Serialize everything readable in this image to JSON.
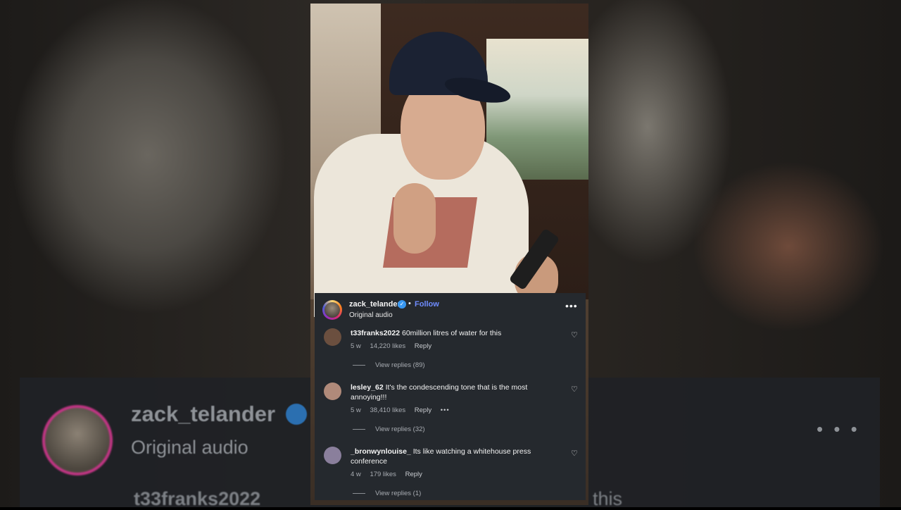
{
  "background": {
    "username": "zack_telander",
    "audio_label": "Original audio",
    "comment_user": "t33franks2022",
    "comment_fragment": "this",
    "more_icon": "• • •"
  },
  "overlay": {
    "header": {
      "username": "zack_telander",
      "separator": "•",
      "follow_label": "Follow",
      "audio_label": "Original audio",
      "more_icon": "•••"
    },
    "comments": [
      {
        "user": "t33franks2022",
        "text": "60million litres of water for this",
        "age": "5 w",
        "likes": "14,220 likes",
        "reply_label": "Reply",
        "view_replies": "View replies (89)",
        "avatar_color": "#6b4f3f"
      },
      {
        "user": "lesley_62",
        "text": "It's the condescending tone that is the most annoying!!!",
        "age": "5 w",
        "likes": "38,410 likes",
        "reply_label": "Reply",
        "more_icon": "•••",
        "view_replies": "View replies (32)",
        "avatar_color": "#b08a7a"
      },
      {
        "user": "_bronwynlouise_",
        "text": "Its like watching a whitehouse press conference",
        "age": "4 w",
        "likes": "179 likes",
        "reply_label": "Reply",
        "view_replies": "View replies (1)",
        "avatar_color": "#8a7f9c"
      }
    ]
  }
}
